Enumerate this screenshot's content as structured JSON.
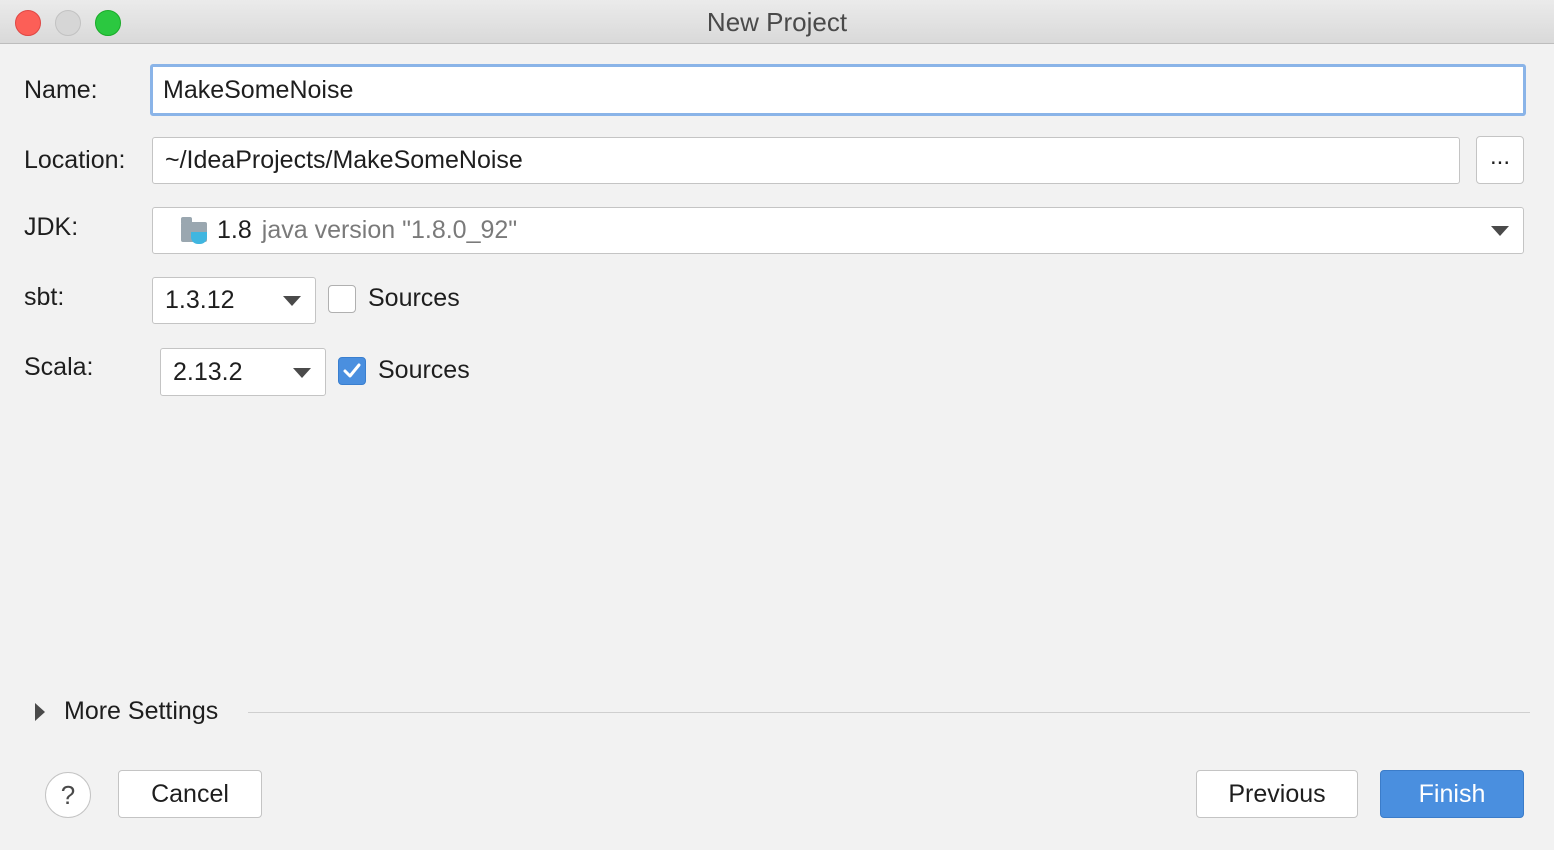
{
  "window": {
    "title": "New Project"
  },
  "form": {
    "name": {
      "label": "Name:",
      "value": "MakeSomeNoise"
    },
    "location": {
      "label": "Location:",
      "value": "~/IdeaProjects/MakeSomeNoise",
      "browse_label": "..."
    },
    "jdk": {
      "label": "JDK:",
      "version": "1.8",
      "description": "java version \"1.8.0_92\"",
      "icon": "jdk-folder-icon"
    },
    "sbt": {
      "label": "sbt:",
      "version": "1.3.12",
      "sources_label": "Sources",
      "sources_checked": false
    },
    "scala": {
      "label": "Scala:",
      "version": "2.13.2",
      "sources_label": "Sources",
      "sources_checked": true
    }
  },
  "more_settings": {
    "label": "More Settings"
  },
  "footer": {
    "help_label": "?",
    "cancel_label": "Cancel",
    "previous_label": "Previous",
    "finish_label": "Finish"
  },
  "colors": {
    "accent": "#4a8fdf",
    "focus_ring": "#8ab4e8",
    "close": "#fc5f57",
    "maximize": "#2bc840"
  }
}
